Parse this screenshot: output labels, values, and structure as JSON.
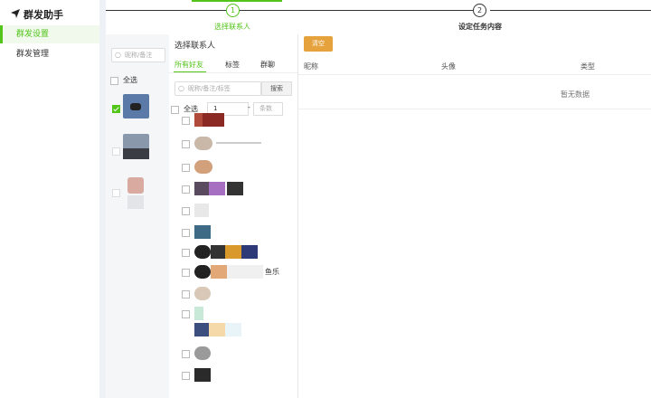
{
  "app": {
    "title": "群发助手"
  },
  "nav": {
    "items": [
      {
        "label": "群发设置",
        "active": true
      },
      {
        "label": "群发管理",
        "active": false
      }
    ]
  },
  "steps": [
    {
      "number": "1",
      "label": "选择联系人",
      "done": true
    },
    {
      "number": "2",
      "label": "设定任务内容",
      "done": false
    }
  ],
  "groups": {
    "search_placeholder": "昵称/备注",
    "select_all": "全选"
  },
  "contacts": {
    "title": "选择联系人",
    "tabs": [
      "所有好友",
      "标签",
      "群聊"
    ],
    "search_placeholder": "昵称/备注/标签",
    "search_button": "搜索",
    "select_all": "全选",
    "range_start": "1",
    "range_separator": "-",
    "range_end_placeholder": "条数",
    "visible_name_fragments": [
      "鱼乐"
    ]
  },
  "task": {
    "clear_button": "清空",
    "columns": [
      "昵称",
      "头像",
      "类型"
    ],
    "empty_text": "暂无数据"
  },
  "colors": {
    "accent": "#52c41a",
    "warning": "#e6a23c"
  }
}
